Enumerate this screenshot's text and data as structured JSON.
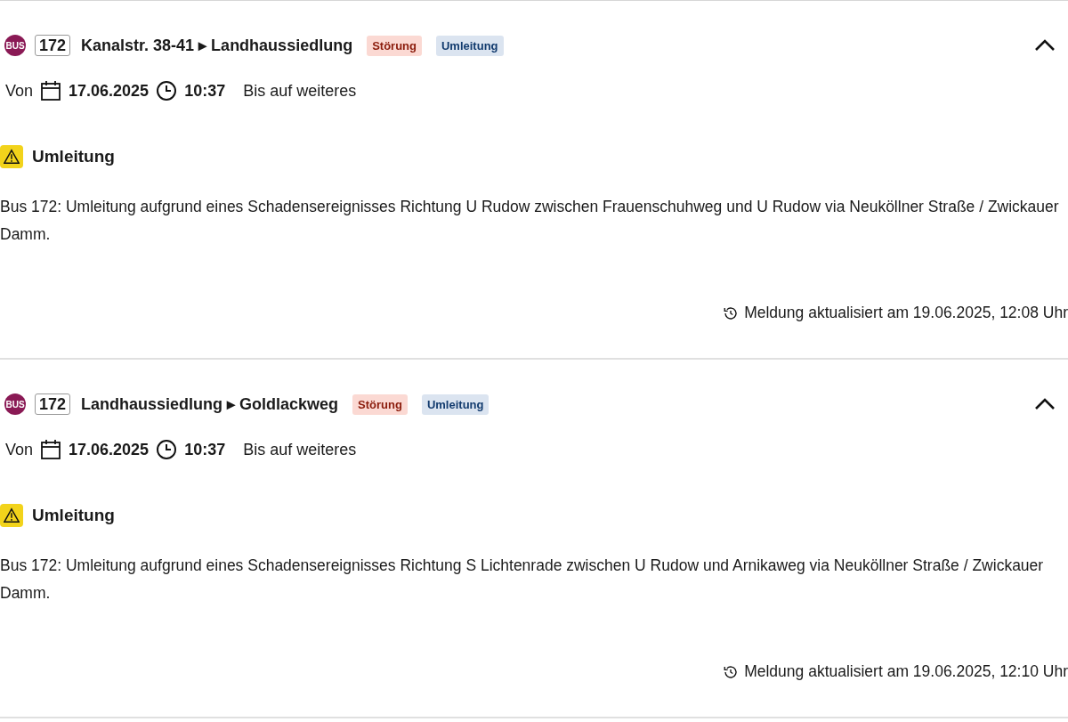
{
  "messages": [
    {
      "mode": "BUS",
      "line": "172",
      "route_from": "Kanalstr. 38-41",
      "arrow": "▸",
      "route_to": "Landhaussiedlung",
      "tags": [
        {
          "label": "Störung",
          "kind": "disruption"
        },
        {
          "label": "Umleitung",
          "kind": "detour"
        }
      ],
      "expanded": true,
      "from_label": "Von",
      "date": "17.06.2025",
      "time": "10:37",
      "until": "Bis auf weiteres",
      "heading": "Umleitung",
      "text": "Bus 172: Umleitung aufgrund eines Schadensereignisses Richtung U Rudow zwischen Frauenschuhweg und U Rudow via Neuköllner Straße / Zwickauer Damm.",
      "updated": "Meldung aktualisiert am 19.06.2025, 12:08 Uhr"
    },
    {
      "mode": "BUS",
      "line": "172",
      "route_from": "Landhaussiedlung",
      "arrow": "▸",
      "route_to": "Goldlackweg",
      "tags": [
        {
          "label": "Störung",
          "kind": "disruption"
        },
        {
          "label": "Umleitung",
          "kind": "detour"
        }
      ],
      "expanded": true,
      "from_label": "Von",
      "date": "17.06.2025",
      "time": "10:37",
      "until": "Bis auf weiteres",
      "heading": "Umleitung",
      "text": "Bus 172: Umleitung aufgrund eines Schadensereignisses Richtung S Lichtenrade zwischen U Rudow und Arnikaweg via Neuköllner Straße / Zwickauer Damm.",
      "updated": "Meldung aktualisiert am 19.06.2025, 12:10 Uhr"
    }
  ]
}
